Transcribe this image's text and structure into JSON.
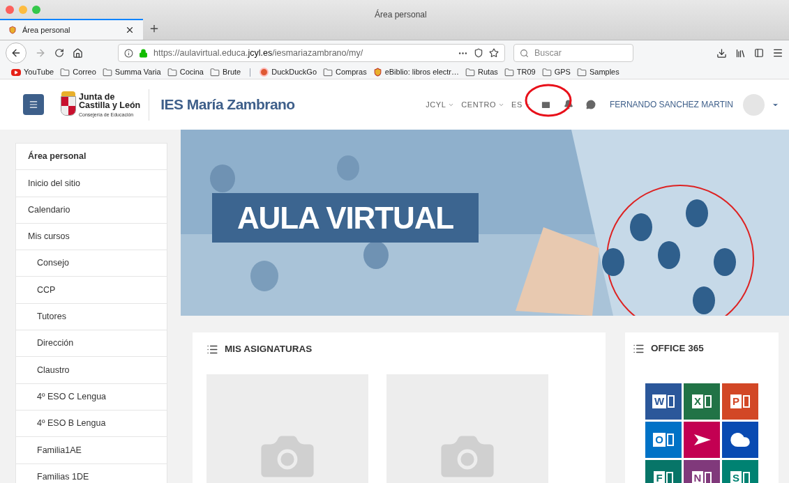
{
  "window": {
    "title": "Área personal"
  },
  "tabs": [
    {
      "label": "Área personal",
      "selected": true
    }
  ],
  "toolbar": {
    "url_prefix": "https://aulavirtual.educa.",
    "url_domain": "jcyl.es",
    "url_suffix": "/iesmariazambrano/my/",
    "search": {
      "placeholder": "Buscar"
    }
  },
  "bookmarks": [
    {
      "kind": "youtube",
      "label": "YouTube"
    },
    {
      "kind": "folder",
      "label": "Correo"
    },
    {
      "kind": "folder",
      "label": "Summa Varia"
    },
    {
      "kind": "folder",
      "label": "Cocina"
    },
    {
      "kind": "folder",
      "label": "Brute"
    },
    {
      "kind": "separator"
    },
    {
      "kind": "duck",
      "label": "DuckDuckGo"
    },
    {
      "kind": "folder",
      "label": "Compras"
    },
    {
      "kind": "site",
      "label": "eBiblio: libros electr…"
    },
    {
      "kind": "folder",
      "label": "Rutas"
    },
    {
      "kind": "folder",
      "label": "TR09"
    },
    {
      "kind": "folder",
      "label": "GPS"
    },
    {
      "kind": "folder",
      "label": "Samples"
    }
  ],
  "header": {
    "logo_line1": "Junta de",
    "logo_line2": "Castilla y León",
    "logo_sub": "Consejería de Educación",
    "site_title": "IES María Zambrano",
    "menus": [
      "JCYL",
      "CENTRO",
      "ES"
    ],
    "user": "FERNANDO SANCHEZ MARTIN"
  },
  "sidebar": {
    "items": [
      {
        "label": "Área personal",
        "selected": true
      },
      {
        "label": "Inicio del sitio",
        "selected": false
      },
      {
        "label": "Calendario",
        "selected": false
      },
      {
        "label": "Mis cursos",
        "selected": false,
        "children": [
          {
            "label": "Consejo",
            "selected": false
          },
          {
            "label": "CCP",
            "selected": false
          },
          {
            "label": "Tutores",
            "selected": false
          },
          {
            "label": "Dirección",
            "selected": false
          },
          {
            "label": "Claustro",
            "selected": false
          },
          {
            "label": "4º ESO C Lengua",
            "selected": false
          },
          {
            "label": "4º ESO B Lengua",
            "selected": false
          },
          {
            "label": "Familia1AE",
            "selected": false
          },
          {
            "label": "Familias 1DE",
            "selected": false
          }
        ]
      }
    ]
  },
  "banner": {
    "kind": "picture",
    "title": "AULA VIRTUAL"
  },
  "courses": {
    "title": "MIS ASIGNATURAS",
    "cards": [
      {
        "kind": "placeholder"
      },
      {
        "kind": "placeholder"
      }
    ]
  },
  "office": {
    "title": "OFFICE 365",
    "tiles": [
      {
        "kind": "letter",
        "letter": "W",
        "color": "#2b579a"
      },
      {
        "kind": "letter",
        "letter": "X",
        "color": "#217346"
      },
      {
        "kind": "letter",
        "letter": "P",
        "color": "#d24726"
      },
      {
        "kind": "letter",
        "letter": "O",
        "color": "#0072c6"
      },
      {
        "kind": "arrow",
        "color": "#c30052"
      },
      {
        "kind": "cloud",
        "color": "#094ab2"
      },
      {
        "kind": "letter",
        "letter": "F",
        "color": "#077568"
      },
      {
        "kind": "letter",
        "letter": "N",
        "color": "#80397b"
      },
      {
        "kind": "letter",
        "letter": "S",
        "color": "#008272"
      }
    ]
  }
}
